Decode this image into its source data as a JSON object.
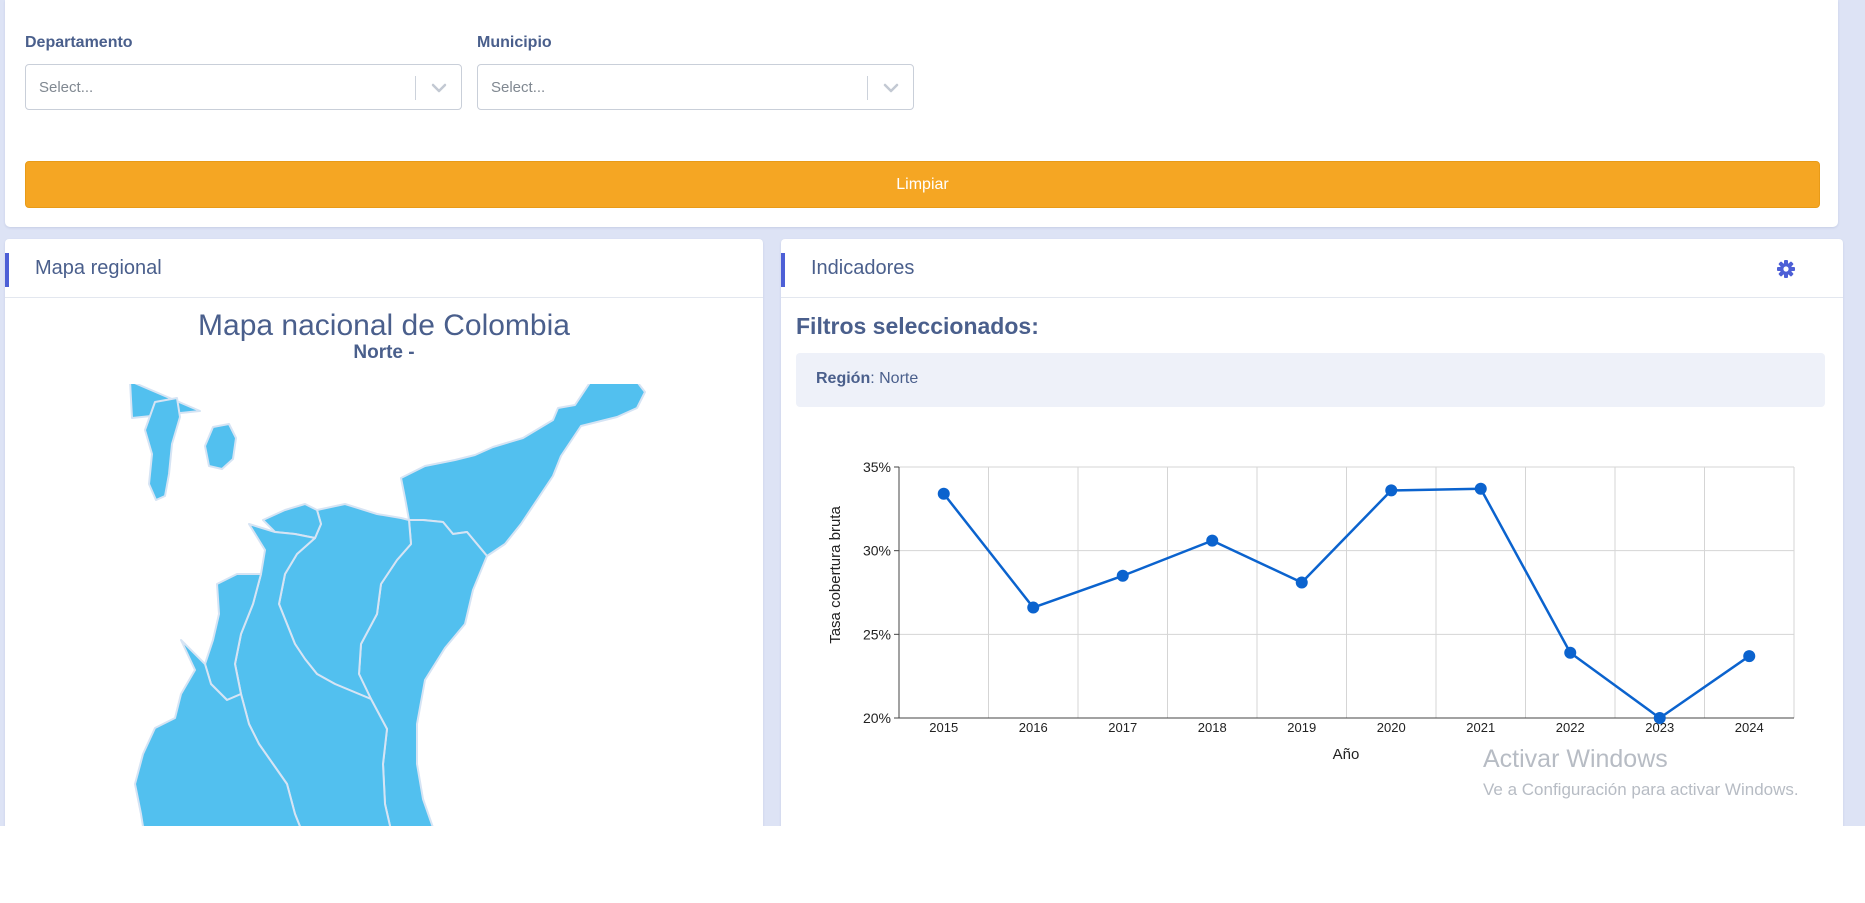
{
  "filters": {
    "departamento": {
      "label": "Departamento",
      "placeholder": "Select..."
    },
    "municipio": {
      "label": "Municipio",
      "placeholder": "Select..."
    },
    "clear_button": "Limpiar"
  },
  "map_panel": {
    "header": "Mapa regional",
    "title": "Mapa nacional de Colombia",
    "subtitle": "Norte -",
    "map_fill": "#52c0ef",
    "map_border": "#d6e4f4"
  },
  "indicators_panel": {
    "header": "Indicadores",
    "settings_icon": "gear-icon",
    "filters_heading": "Filtros seleccionados:",
    "region_key": "Región",
    "region_value": "Norte"
  },
  "chart_data": {
    "type": "line",
    "x": [
      "2015",
      "2016",
      "2017",
      "2018",
      "2019",
      "2020",
      "2021",
      "2022",
      "2023",
      "2024"
    ],
    "series": [
      {
        "values": [
          33.4,
          26.6,
          28.5,
          30.6,
          28.1,
          33.6,
          33.7,
          23.9,
          20.0,
          23.7
        ],
        "color": "#0b63ce"
      }
    ],
    "y_ticks": [
      "20%",
      "25%",
      "30%",
      "35%"
    ],
    "ylim": [
      20,
      35
    ],
    "xlabel": "Año",
    "ylabel": "Tasa cobertura bruta",
    "grid": true
  },
  "watermark": {
    "title": "Activar Windows",
    "subtitle": "Ve a Configuración para activar Windows."
  },
  "colors": {
    "accent": "#4d5fd6",
    "button": "#f5a623",
    "text": "#4a5f8c",
    "background": "#dde3f5"
  }
}
